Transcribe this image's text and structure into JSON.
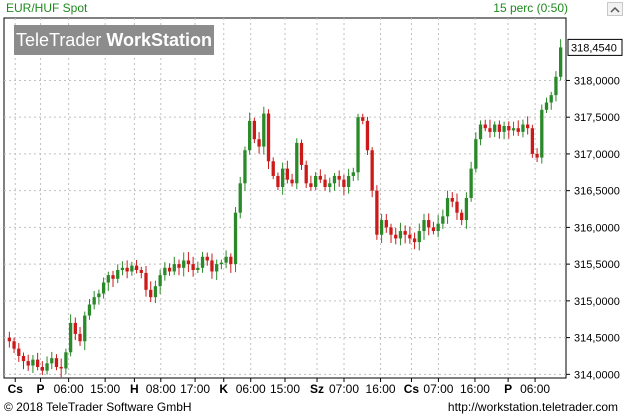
{
  "title_bar": {
    "symbol": "EUR/HUF Spot",
    "interval": "15 perc (0:50)"
  },
  "watermark": {
    "brand_regular": "TeleTrader ",
    "brand_bold": "WorkStation"
  },
  "footer": {
    "copyright": "© 2018 TeleTrader Software GmbH",
    "site": "http://workstation.teletrader.com"
  },
  "colors": {
    "up": "#2a8a2a",
    "down": "#cc1a1a",
    "grid": "#c0c0c0",
    "last_price_box": "#ffffff"
  },
  "chart_data": {
    "type": "candlestick",
    "title": "EUR/HUF Spot",
    "interval": "15 perc (0:50)",
    "last_price": "318,4540",
    "y_axis": {
      "position": "right",
      "ylim": [
        313.95,
        318.85
      ],
      "ticks": [
        {
          "value": 314.0,
          "label": "314,0000"
        },
        {
          "value": 314.5,
          "label": "314,5000"
        },
        {
          "value": 315.0,
          "label": "315,0000"
        },
        {
          "value": 315.5,
          "label": "315,5000"
        },
        {
          "value": 316.0,
          "label": "316,0000"
        },
        {
          "value": 316.5,
          "label": "316,5000"
        },
        {
          "value": 317.0,
          "label": "317,0000"
        },
        {
          "value": 317.5,
          "label": "317,5000"
        },
        {
          "value": 318.0,
          "label": "318,0000"
        }
      ]
    },
    "x_axis": {
      "ticks": [
        {
          "label": "Cs",
          "bold": true,
          "pos": 0.02
        },
        {
          "label": "P",
          "bold": true,
          "pos": 0.065
        },
        {
          "label": "06:00",
          "bold": false,
          "pos": 0.115
        },
        {
          "label": "15:00",
          "bold": false,
          "pos": 0.18
        },
        {
          "label": "H",
          "bold": true,
          "pos": 0.232
        },
        {
          "label": "08:00",
          "bold": false,
          "pos": 0.279
        },
        {
          "label": "17:00",
          "bold": false,
          "pos": 0.34
        },
        {
          "label": "K",
          "bold": true,
          "pos": 0.391
        },
        {
          "label": "06:00",
          "bold": false,
          "pos": 0.439
        },
        {
          "label": "15:00",
          "bold": false,
          "pos": 0.5
        },
        {
          "label": "Sz",
          "bold": true,
          "pos": 0.557
        },
        {
          "label": "07:00",
          "bold": false,
          "pos": 0.605
        },
        {
          "label": "16:00",
          "bold": false,
          "pos": 0.67
        },
        {
          "label": "Cs",
          "bold": true,
          "pos": 0.725
        },
        {
          "label": "07:00",
          "bold": false,
          "pos": 0.773
        },
        {
          "label": "16:00",
          "bold": false,
          "pos": 0.838
        },
        {
          "label": "P",
          "bold": true,
          "pos": 0.897
        },
        {
          "label": "06:00",
          "bold": false,
          "pos": 0.945
        }
      ]
    },
    "grid": true,
    "series": [
      {
        "values": [
          314.45,
          314.35,
          314.25,
          314.18,
          314.12,
          314.2,
          314.1,
          314.05,
          314.15,
          314.22,
          314.1,
          314.08,
          314.3,
          314.7,
          314.55,
          314.45,
          314.8,
          314.95,
          315.05,
          315.1,
          315.25,
          315.35,
          315.3,
          315.42,
          315.45,
          315.4,
          315.48,
          315.42,
          315.38,
          315.15,
          315.05,
          315.2,
          315.35,
          315.45,
          315.4,
          315.5,
          315.45,
          315.55,
          315.5,
          315.42,
          315.45,
          315.6,
          315.55,
          315.4,
          315.5,
          315.52,
          315.6,
          315.5,
          316.2,
          316.6,
          317.05,
          317.45,
          317.2,
          317.1,
          317.55,
          316.9,
          316.7,
          316.55,
          316.8,
          316.65,
          316.6,
          317.15,
          316.85,
          316.6,
          316.55,
          316.7,
          316.65,
          316.55,
          316.6,
          316.7,
          316.65,
          316.55,
          316.7,
          316.75,
          317.5,
          317.45,
          317.05,
          316.5,
          315.9,
          316.1,
          316.0,
          315.9,
          315.85,
          315.95,
          315.9,
          315.85,
          315.8,
          315.95,
          316.1,
          316.0,
          315.95,
          316.05,
          316.15,
          316.4,
          316.35,
          316.2,
          316.1,
          316.4,
          316.8,
          317.2,
          317.4,
          317.35,
          317.3,
          317.4,
          317.3,
          317.38,
          317.32,
          317.35,
          317.3,
          317.4,
          317.35,
          317.0,
          316.95,
          317.6,
          317.7,
          317.8,
          318.05,
          318.45
        ]
      }
    ]
  }
}
